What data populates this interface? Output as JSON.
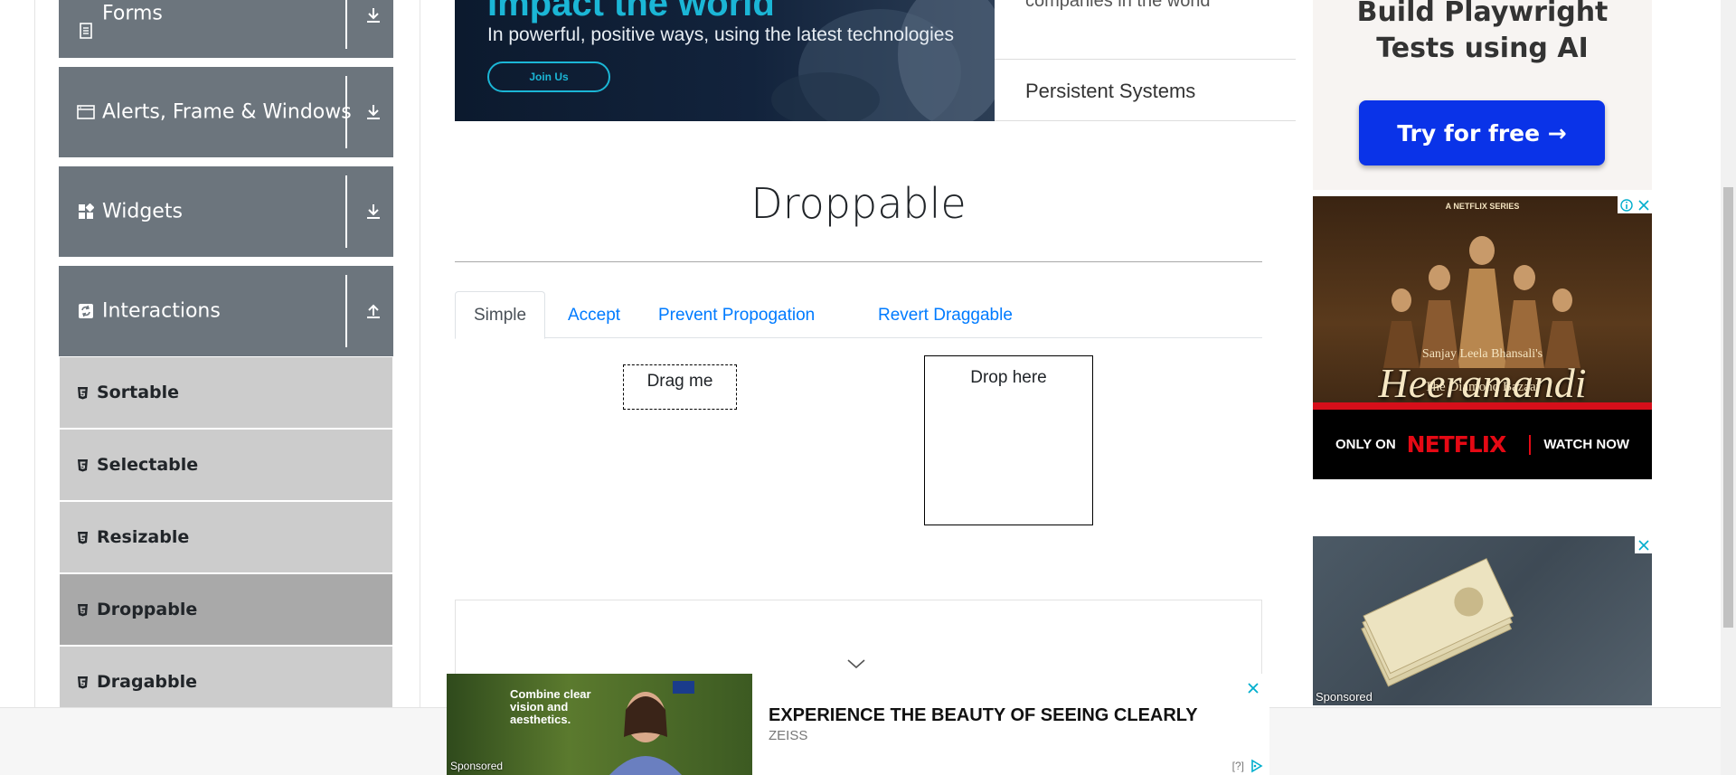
{
  "sidebar": {
    "groups": [
      {
        "label": "Forms",
        "icon": "document-icon",
        "toggle": "download-icon"
      },
      {
        "label": "Alerts, Frame & Windows",
        "icon": "window-icon",
        "toggle": "download-icon"
      },
      {
        "label": "Widgets",
        "icon": "widgets-icon",
        "toggle": "download-icon"
      },
      {
        "label": "Interactions",
        "icon": "interactions-icon",
        "toggle": "upload-icon"
      }
    ],
    "items": [
      {
        "label": "Sortable"
      },
      {
        "label": "Selectable"
      },
      {
        "label": "Resizable"
      },
      {
        "label": "Droppable",
        "active": true
      },
      {
        "label": "Dragabble"
      }
    ]
  },
  "top_ad": {
    "headline": "Impact the world",
    "subtitle": "In powerful, positive ways, using the latest technologies",
    "button": "Join Us",
    "side_top_text": "companies in the world",
    "company": "Persistent Systems",
    "accent_color": "#1bb6d6"
  },
  "main": {
    "title": "Droppable",
    "tabs": [
      {
        "label": "Simple",
        "active": true
      },
      {
        "label": "Accept"
      },
      {
        "label": "Prevent Propogation"
      },
      {
        "label": "Revert Draggable"
      }
    ],
    "drag_label": "Drag me",
    "drop_label": "Drop here"
  },
  "right_ads": {
    "playwright": {
      "title": "Build Playwright Tests using AI",
      "button": "Try for free →",
      "button_color": "#0a33e8"
    },
    "netflix": {
      "series": "A NETFLIX SERIES",
      "presenter": "Sanjay Leela Bhansali's",
      "title": "Heeramandi",
      "subtitle": "The Diamond Bazaar",
      "only_on": "ONLY ON",
      "brand": "NETFLIX",
      "cta": "WATCH NOW"
    },
    "atm": {
      "sponsored": "Sponsored"
    }
  },
  "bottom_ad": {
    "image_text": "Combine clear vision and aesthetics.",
    "sponsored": "Sponsored",
    "headline": "EXPERIENCE THE BEAUTY OF SEEING CLEARLY",
    "brand": "ZEISS",
    "help": "[?]"
  },
  "colors": {
    "sidebar_group_bg": "#6c757d",
    "sidebar_item_bg": "#cccccc",
    "sidebar_item_active_bg": "#a9a9a9",
    "link_blue": "#007bff"
  }
}
